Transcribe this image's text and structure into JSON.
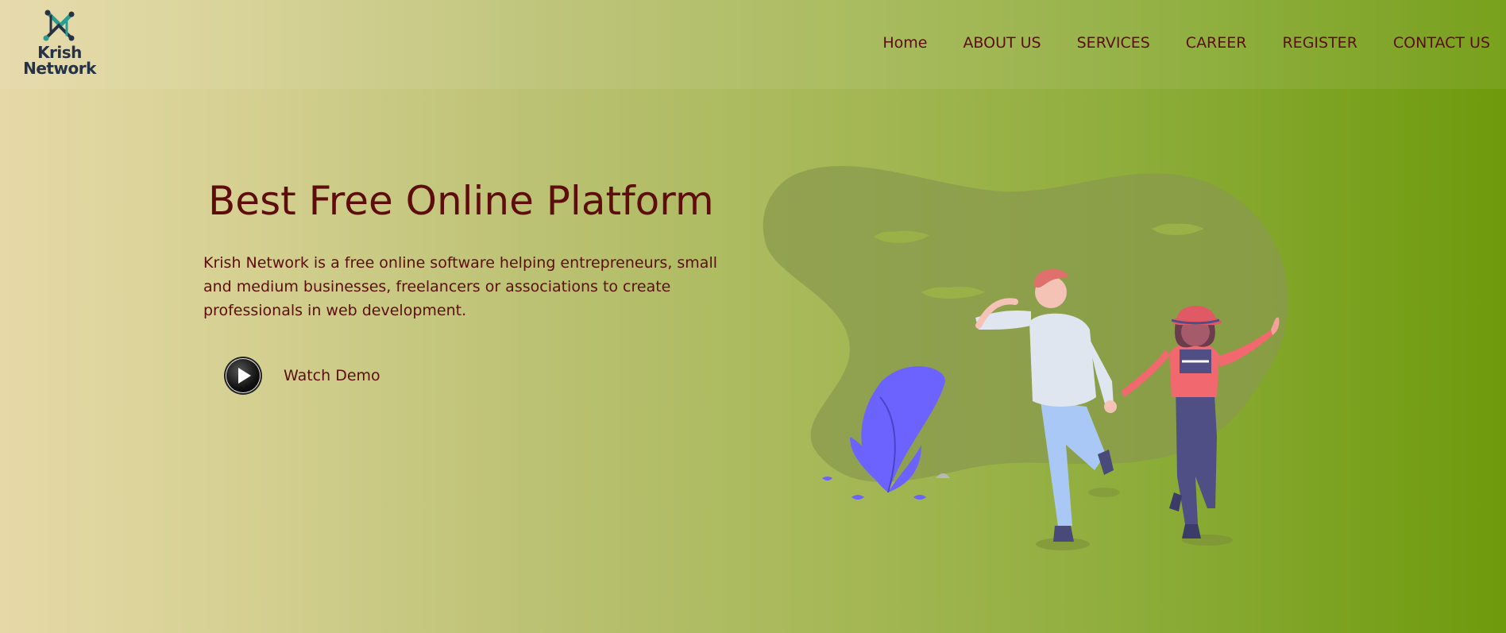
{
  "brand": {
    "name_line1": "Krish",
    "name_line2": "Network",
    "logo_icon": "krish-network-logo-icon"
  },
  "nav": {
    "items": [
      {
        "label": "Home"
      },
      {
        "label": "ABOUT US"
      },
      {
        "label": "SERVICES"
      },
      {
        "label": "CAREER"
      },
      {
        "label": "REGISTER"
      },
      {
        "label": "CONTACT US"
      }
    ]
  },
  "hero": {
    "title": "Best Free Online Platform",
    "description": "Krish Network is a free online software helping entrepreneurs, small and medium businesses, freelancers or associations to create professionals in web development.",
    "watch_demo_label": "Watch Demo",
    "play_icon": "play-icon"
  },
  "colors": {
    "text": "#5e0d0d",
    "gradient_start": "#e6d9a8",
    "gradient_end": "#6e9a0c",
    "logo_text": "#263347",
    "plant": "#6c63ff"
  }
}
